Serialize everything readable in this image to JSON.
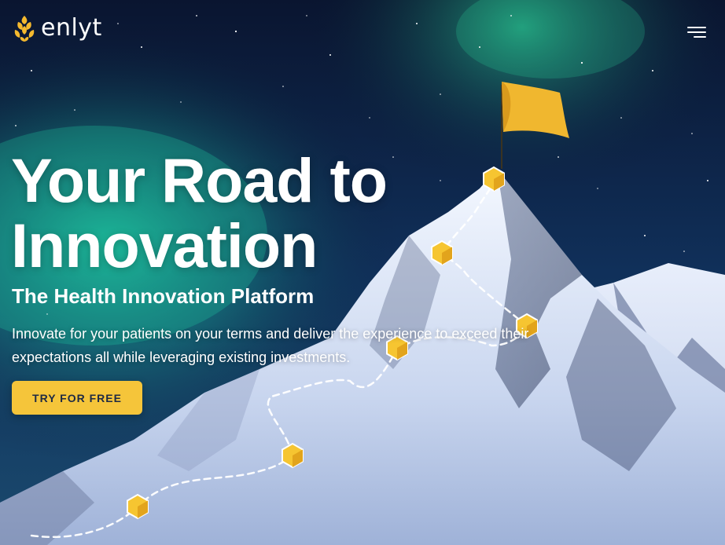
{
  "header": {
    "logo_text": "enlyt",
    "logo_icon": "pinecone-logo-icon",
    "menu_icon": "hamburger-menu-icon"
  },
  "hero": {
    "headline": "Your Road to Innovation",
    "subheadline": "The Health Innovation Platform",
    "description": "Innovate for your patients on your terms and deliver the experience to exceed their expectations all while leveraging existing investments.",
    "cta_label": "TRY FOR FREE"
  },
  "colors": {
    "accent": "#f5c53a",
    "text": "#ffffff",
    "cta_text": "#1e2a44",
    "sky": "#0b1a3a",
    "aurora": "#1fd6a8"
  }
}
